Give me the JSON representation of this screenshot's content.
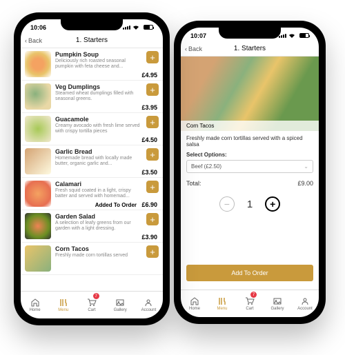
{
  "status": {
    "time_a": "10:06",
    "time_b": "10:07"
  },
  "nav": {
    "back": "Back",
    "title": "1. Starters"
  },
  "items": [
    {
      "name": "Pumpkin Soup",
      "desc": "Deliciously rich roasted seasonal pumpkin with feta cheese and...",
      "price": "£4.95"
    },
    {
      "name": "Veg Dumplings",
      "desc": "Steamed wheat dumplings filled with seasonal greens.",
      "price": "£3.95"
    },
    {
      "name": "Guacamole",
      "desc": "Creamy avocado with fresh lime served with crispy tortilla pieces",
      "price": "£4.50"
    },
    {
      "name": "Garlic Bread",
      "desc": "Homemade bread with locally made butter, organic garlic and...",
      "price": "£3.50"
    },
    {
      "name": "Calamari",
      "desc": "Fresh squid coated in a light, crispy batter and served with homemad...",
      "price": "£6.90",
      "added": "Added To Order"
    },
    {
      "name": "Garden Salad",
      "desc": "A selection of leafy greens from our garden with a light dressing.",
      "price": "£3.90"
    },
    {
      "name": "Corn Tacos",
      "desc": "Freshly made corn tortillas served",
      "price": ""
    }
  ],
  "detail": {
    "name": "Corn Tacos",
    "desc": "Freshly made corn tortillas served with a spiced salsa",
    "select_label": "Select Options:",
    "option": "Beef (£2.50)",
    "total_label": "Total:",
    "total": "£9.00",
    "qty": "1",
    "add_btn": "Add To Order"
  },
  "tabs": [
    {
      "label": "Home"
    },
    {
      "label": "Menu"
    },
    {
      "label": "Cart",
      "badge": "7"
    },
    {
      "label": "Gallery"
    },
    {
      "label": "Account"
    }
  ]
}
